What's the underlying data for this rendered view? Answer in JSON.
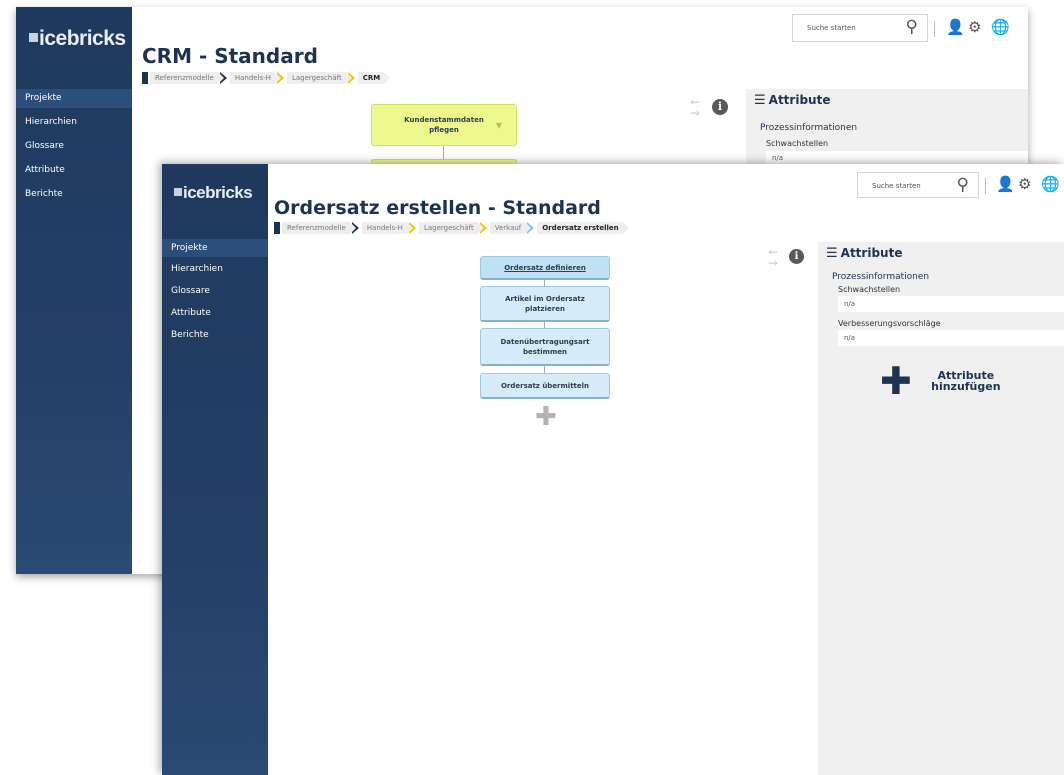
{
  "app": {
    "logo_text": "icebricks"
  },
  "nav": [
    "Projekte",
    "Hierarchien",
    "Glossare",
    "Attribute",
    "Berichte"
  ],
  "search": {
    "placeholder": "Suche starten"
  },
  "back_window": {
    "title": "CRM - Standard",
    "breadcrumb": [
      "Referenzmodelle",
      "Handels-H",
      "Lagergeschäft",
      "CRM"
    ],
    "steps": [
      {
        "label": "Kundenstammdaten pflegen"
      }
    ],
    "panel": {
      "header": "Attribute",
      "section": "Prozessinformationen",
      "fields": [
        {
          "label": "Schwachstellen",
          "value": "n/a"
        }
      ]
    }
  },
  "front_window": {
    "title": "Ordersatz erstellen - Standard",
    "breadcrumb": [
      "Referenzmodelle",
      "Handels-H",
      "Lagergeschäft",
      "Verkauf",
      "Ordersatz erstellen"
    ],
    "steps": [
      {
        "label": "Ordersatz definieren"
      },
      {
        "label": "Artikel im Ordersatz platzieren"
      },
      {
        "label": "Datenübertragungsart bestimmen"
      },
      {
        "label": "Ordersatz übermitteln"
      }
    ],
    "panel": {
      "header": "Attribute",
      "section": "Prozessinformationen",
      "fields": [
        {
          "label": "Schwachstellen",
          "value": "n/a"
        },
        {
          "label": "Verbesserungsvorschläge",
          "value": "n/a"
        }
      ],
      "add_label": "Attribute hinzufügen"
    }
  },
  "icons": [
    "search-icon",
    "user-icon",
    "gear-icon",
    "globe-icon",
    "swap-arrows-icon",
    "info-icon",
    "list-icon",
    "plus-icon"
  ],
  "colors": {
    "sidebar": "#1f3a5e",
    "yellow_step": "#edf98c",
    "blue_step": "#d6ecf8",
    "title": "#1e3352"
  }
}
